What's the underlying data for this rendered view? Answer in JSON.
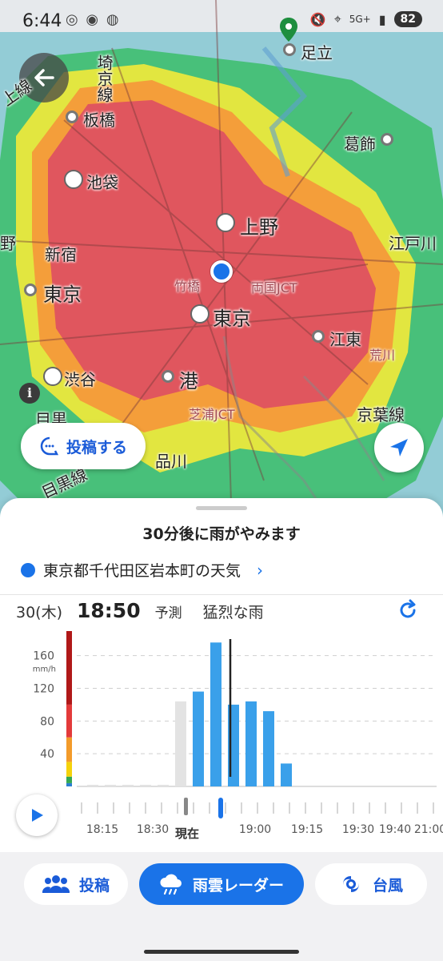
{
  "status": {
    "time": "6:44",
    "network": "5G+",
    "battery": "82"
  },
  "map": {
    "labels": {
      "adachi": "足立",
      "saikyo_line": "埼京線",
      "itabashi": "板橋",
      "katsushika": "葛飾",
      "ikebukuro": "池袋",
      "ueno": "上野",
      "edogawa": "江戸川",
      "shinjuku": "新宿",
      "tokyo_ward": "東京",
      "takebashi": "竹橋",
      "ryogoku_jct": "両国JCT",
      "tokyo_station": "東京",
      "koto": "江東",
      "shibuya": "渋谷",
      "minato": "港",
      "meguro": "目黒",
      "shibaura_jct": "芝浦JCT",
      "keiyo_line": "京葉線",
      "shinagawa": "品川",
      "meguro_line": "目黒線",
      "arakawa": "荒川",
      "kami_line": "上線"
    },
    "post_button": "投稿する"
  },
  "sheet": {
    "headline": "30分後に雨がやみます",
    "location": "東京都千代田区岩本町の天気",
    "day": "30(木)",
    "time": "18:50",
    "forecast_label": "予測",
    "rain_desc": "猛烈な雨"
  },
  "chart_data": {
    "type": "bar",
    "title": "",
    "ylabel": "mm/h",
    "ylim": [
      0,
      190
    ],
    "yticks": [
      40,
      80,
      120,
      160
    ],
    "y_unit_label": "mm/h",
    "series": [
      {
        "name": "",
        "values": [
          0,
          0,
          0,
          0,
          0,
          104,
          116,
          176,
          100,
          104,
          92,
          28
        ]
      }
    ],
    "bar_kinds": [
      "past",
      "past",
      "past",
      "past",
      "past",
      "past",
      "forecast",
      "forecast",
      "forecast",
      "forecast",
      "forecast",
      "forecast"
    ],
    "current_index": 8,
    "colors": {
      "past": "#e3e3e3",
      "forecast": "#3aa0ea",
      "cursor": "#222222"
    }
  },
  "timeline": {
    "labels": [
      "18:15",
      "18:30",
      "19:00",
      "19:15",
      "19:30",
      "19:40",
      "21:00"
    ],
    "now_label": "現在"
  },
  "tabs": [
    {
      "label": "投稿"
    },
    {
      "label": "雨雲レーダー"
    },
    {
      "label": "台風"
    }
  ]
}
